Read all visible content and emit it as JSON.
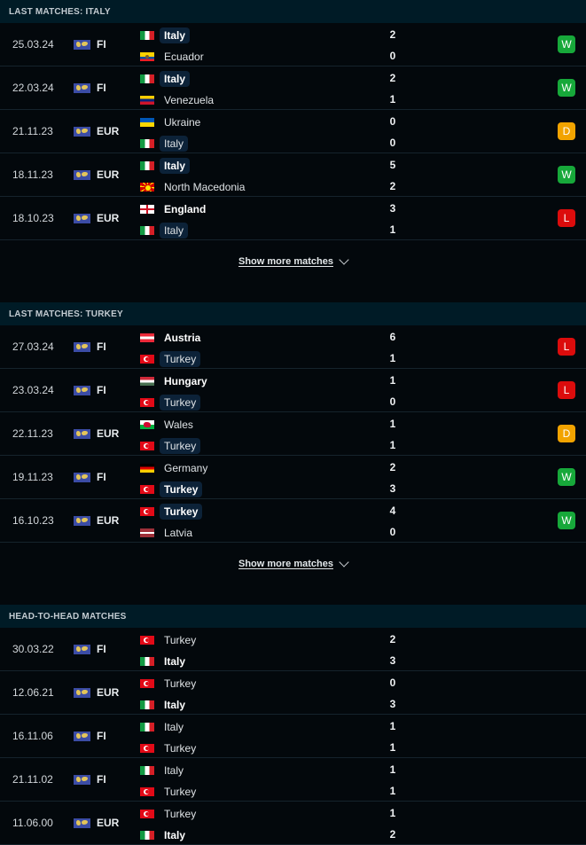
{
  "sections": [
    {
      "title": "LAST MATCHES: ITALY",
      "show_more_label": "Show more matches",
      "matches": [
        {
          "date": "25.03.24",
          "competition": "FI",
          "home": {
            "name": "Italy",
            "flag": "italy",
            "bold": true,
            "highlight": true
          },
          "away": {
            "name": "Ecuador",
            "flag": "ecuador",
            "bold": false,
            "highlight": false
          },
          "home_score": "2",
          "away_score": "0",
          "result": "W"
        },
        {
          "date": "22.03.24",
          "competition": "FI",
          "home": {
            "name": "Italy",
            "flag": "italy",
            "bold": true,
            "highlight": true
          },
          "away": {
            "name": "Venezuela",
            "flag": "venezuela",
            "bold": false,
            "highlight": false
          },
          "home_score": "2",
          "away_score": "1",
          "result": "W"
        },
        {
          "date": "21.11.23",
          "competition": "EUR",
          "home": {
            "name": "Ukraine",
            "flag": "ukraine",
            "bold": false,
            "highlight": false
          },
          "away": {
            "name": "Italy",
            "flag": "italy",
            "bold": false,
            "highlight": true
          },
          "home_score": "0",
          "away_score": "0",
          "result": "D"
        },
        {
          "date": "18.11.23",
          "competition": "EUR",
          "home": {
            "name": "Italy",
            "flag": "italy",
            "bold": true,
            "highlight": true
          },
          "away": {
            "name": "North Macedonia",
            "flag": "north-macedonia",
            "bold": false,
            "highlight": false
          },
          "home_score": "5",
          "away_score": "2",
          "result": "W"
        },
        {
          "date": "18.10.23",
          "competition": "EUR",
          "home": {
            "name": "England",
            "flag": "england",
            "bold": true,
            "highlight": false
          },
          "away": {
            "name": "Italy",
            "flag": "italy",
            "bold": false,
            "highlight": true
          },
          "home_score": "3",
          "away_score": "1",
          "result": "L"
        }
      ]
    },
    {
      "title": "LAST MATCHES: TURKEY",
      "show_more_label": "Show more matches",
      "matches": [
        {
          "date": "27.03.24",
          "competition": "FI",
          "home": {
            "name": "Austria",
            "flag": "austria",
            "bold": true,
            "highlight": false
          },
          "away": {
            "name": "Turkey",
            "flag": "turkey",
            "bold": false,
            "highlight": true
          },
          "home_score": "6",
          "away_score": "1",
          "result": "L"
        },
        {
          "date": "23.03.24",
          "competition": "FI",
          "home": {
            "name": "Hungary",
            "flag": "hungary",
            "bold": true,
            "highlight": false
          },
          "away": {
            "name": "Turkey",
            "flag": "turkey",
            "bold": false,
            "highlight": true
          },
          "home_score": "1",
          "away_score": "0",
          "result": "L"
        },
        {
          "date": "22.11.23",
          "competition": "EUR",
          "home": {
            "name": "Wales",
            "flag": "wales",
            "bold": false,
            "highlight": false
          },
          "away": {
            "name": "Turkey",
            "flag": "turkey",
            "bold": false,
            "highlight": true
          },
          "home_score": "1",
          "away_score": "1",
          "result": "D"
        },
        {
          "date": "19.11.23",
          "competition": "FI",
          "home": {
            "name": "Germany",
            "flag": "germany",
            "bold": false,
            "highlight": false
          },
          "away": {
            "name": "Turkey",
            "flag": "turkey",
            "bold": true,
            "highlight": true
          },
          "home_score": "2",
          "away_score": "3",
          "result": "W"
        },
        {
          "date": "16.10.23",
          "competition": "EUR",
          "home": {
            "name": "Turkey",
            "flag": "turkey",
            "bold": true,
            "highlight": true
          },
          "away": {
            "name": "Latvia",
            "flag": "latvia",
            "bold": false,
            "highlight": false
          },
          "home_score": "4",
          "away_score": "0",
          "result": "W"
        }
      ]
    },
    {
      "title": "HEAD-TO-HEAD MATCHES",
      "matches": [
        {
          "date": "30.03.22",
          "competition": "FI",
          "home": {
            "name": "Turkey",
            "flag": "turkey",
            "bold": false,
            "highlight": false
          },
          "away": {
            "name": "Italy",
            "flag": "italy",
            "bold": true,
            "highlight": false
          },
          "home_score": "2",
          "away_score": "3"
        },
        {
          "date": "12.06.21",
          "competition": "EUR",
          "home": {
            "name": "Turkey",
            "flag": "turkey",
            "bold": false,
            "highlight": false
          },
          "away": {
            "name": "Italy",
            "flag": "italy",
            "bold": true,
            "highlight": false
          },
          "home_score": "0",
          "away_score": "3"
        },
        {
          "date": "16.11.06",
          "competition": "FI",
          "home": {
            "name": "Italy",
            "flag": "italy",
            "bold": false,
            "highlight": false
          },
          "away": {
            "name": "Turkey",
            "flag": "turkey",
            "bold": false,
            "highlight": false
          },
          "home_score": "1",
          "away_score": "1"
        },
        {
          "date": "21.11.02",
          "competition": "FI",
          "home": {
            "name": "Italy",
            "flag": "italy",
            "bold": false,
            "highlight": false
          },
          "away": {
            "name": "Turkey",
            "flag": "turkey",
            "bold": false,
            "highlight": false
          },
          "home_score": "1",
          "away_score": "1"
        },
        {
          "date": "11.06.00",
          "competition": "EUR",
          "home": {
            "name": "Turkey",
            "flag": "turkey",
            "bold": false,
            "highlight": false
          },
          "away": {
            "name": "Italy",
            "flag": "italy",
            "bold": true,
            "highlight": false
          },
          "home_score": "1",
          "away_score": "2"
        }
      ]
    }
  ],
  "icons": {
    "competition": "world-map-icon",
    "show_more": "chevron-down-icon"
  },
  "colors": {
    "win": "#17a83a",
    "draw": "#f2a300",
    "loss": "#dc0c0c",
    "header_bg": "#001b26",
    "highlight_bg": "#0c2238"
  }
}
